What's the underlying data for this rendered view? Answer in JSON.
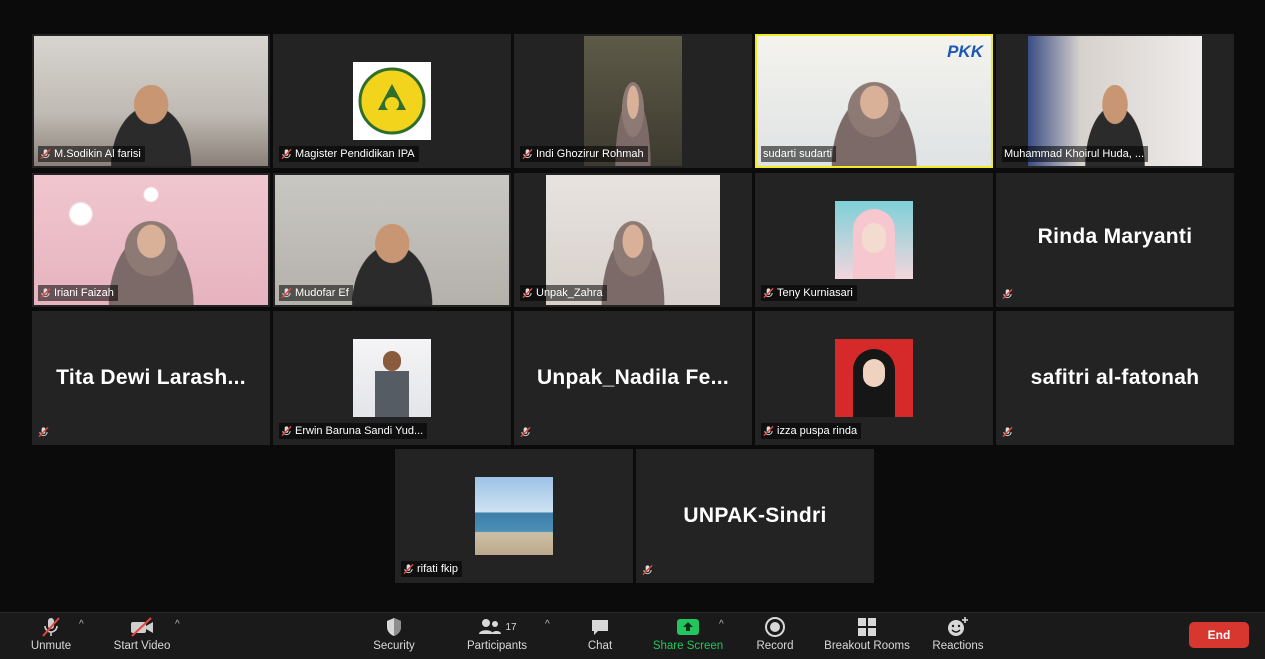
{
  "colors": {
    "active_speaker_border": "#f2ea27",
    "share_screen": "#22c55e",
    "end_button": "#d7372f",
    "muted_icon": "#e0473e"
  },
  "participants": {
    "p01": {
      "name": "M.Sodikin Al farisi"
    },
    "p02": {
      "name": "Magister Pendidikan IPA"
    },
    "p03": {
      "name": "Indi Ghozirur Rohmah"
    },
    "p04": {
      "name": "sudarti sudarti",
      "speaking": true
    },
    "p05": {
      "name": "Muhammad Khoirul Huda, ..."
    },
    "p06": {
      "name": "Iriani Faizah"
    },
    "p07": {
      "name": "Mudofar Ef"
    },
    "p08": {
      "name": "Unpak_Zahra"
    },
    "p09": {
      "name": "Teny Kurniasari"
    },
    "p10": {
      "display": "Rinda Maryanti"
    },
    "p11": {
      "display": "Tita Dewi Larash..."
    },
    "p12": {
      "name": "Erwin Baruna Sandi Yud..."
    },
    "p13": {
      "display": "Unpak_Nadila Fe..."
    },
    "p14": {
      "name": "izza puspa rinda"
    },
    "p15": {
      "display": "safitri al-fatonah"
    },
    "p16": {
      "name": "rifati fkip"
    },
    "p17": {
      "display": "UNPAK-Sindri"
    }
  },
  "toolbar": {
    "unmute": "Unmute",
    "start_video": "Start Video",
    "security": "Security",
    "participants": "Participants",
    "participants_count": "17",
    "chat": "Chat",
    "share_screen": "Share Screen",
    "record": "Record",
    "breakout_rooms": "Breakout Rooms",
    "reactions": "Reactions",
    "end": "End",
    "caret": "^"
  },
  "icons": {
    "unmute": "microphone-muted-icon",
    "start_video": "video-off-icon",
    "security": "shield-icon",
    "participants": "people-icon",
    "chat": "chat-bubble-icon",
    "share_screen": "share-up-arrow-icon",
    "record": "record-icon",
    "breakout_rooms": "grid-icon",
    "reactions": "smiley-plus-icon"
  },
  "tile_content": {
    "p02": "university-logo",
    "p04_banner": "PKK"
  }
}
